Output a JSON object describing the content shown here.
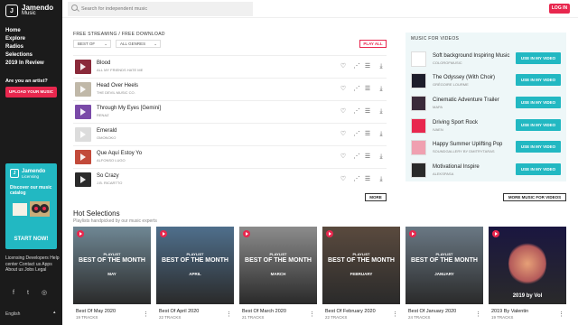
{
  "brand": {
    "mark": "J",
    "name": "Jamendo",
    "sub": "Music"
  },
  "nav": [
    "Home",
    "Explore",
    "Radios",
    "Selections",
    "2019 In Review"
  ],
  "artist_question": "Are you an artist?",
  "upload_label": "UPLOAD YOUR MUSIC",
  "licensing": {
    "title": "Jamendo",
    "sub": "Licensing",
    "text": "Discover our music catalog",
    "cta": "START NOW!"
  },
  "footer_links": "Licensing  Developers  Help center  Contact us  Apps  About us  Jobs  Legal",
  "language": "English",
  "search": {
    "placeholder": "Search for independent music"
  },
  "login_label": "LOG IN",
  "streaming_title": "FREE STREAMING / FREE DOWNLOAD",
  "filters": {
    "sort": "BEST OF",
    "genre": "ALL GENRES"
  },
  "play_all": "PLAY ALL",
  "tracks": [
    {
      "title": "Blood",
      "artist": "ALL MY FRIENDS HATE ME",
      "color": "#8a2a3a"
    },
    {
      "title": "Head Over Heels",
      "artist": "THE DEVIL MUSIC CO.",
      "color": "#c0b8a8"
    },
    {
      "title": "Through My Eyes [Gemini]",
      "artist": "RENAZ",
      "color": "#7a4aa8"
    },
    {
      "title": "Emerald",
      "artist": "OMONOKO",
      "color": "#dcdcdc"
    },
    {
      "title": "Que Aquí Estoy Yo",
      "artist": "ALFONSO LUGO",
      "color": "#c24a3a"
    },
    {
      "title": "So Crazy",
      "artist": "J.B. RICARTTO",
      "color": "#2a2a2a"
    }
  ],
  "more_label": "MORE",
  "hot_title": "Hot Selections",
  "hot_sub": "Playlists handpicked by our music experts",
  "playlists": [
    {
      "kicker": "PLAYLIST",
      "label": "BEST OF THE MONTH",
      "month": "MAY",
      "name": "Best Of May 2020",
      "count": "19 TRACKS",
      "bg": "#6f8794"
    },
    {
      "kicker": "PLAYLIST",
      "label": "BEST OF THE MONTH",
      "month": "APRIL",
      "name": "Best Of April 2020",
      "count": "22 TRACKS",
      "bg": "#4f6f8c"
    },
    {
      "kicker": "PLAYLIST",
      "label": "BEST OF THE MONTH",
      "month": "MARCH",
      "name": "Best Of March 2020",
      "count": "21 TRACKS",
      "bg": "#8c8c8c"
    },
    {
      "kicker": "PLAYLIST",
      "label": "BEST OF THE MONTH",
      "month": "FEBRUARY",
      "name": "Best Of February 2020",
      "count": "22 TRACKS",
      "bg": "#5a4a3e"
    },
    {
      "kicker": "PLAYLIST",
      "label": "BEST OF THE MONTH",
      "month": "JANUARY",
      "name": "Best Of January 2020",
      "count": "24 TRACKS",
      "bg": "#6a7884"
    },
    {
      "kicker": "",
      "label": "2019 by Vol",
      "month": "",
      "name": "2019 By Valentin",
      "count": "19 TRACKS",
      "bg": "#1a1640"
    }
  ],
  "videos_title": "MUSIC FOR VIDEOS",
  "videos": [
    {
      "title": "Soft background Inspiring Music",
      "artist": "COLOROFMUSIC",
      "color": "#ffffff"
    },
    {
      "title": "The Odyssey (With Choir)",
      "artist": "GRÉGOIRE LOURME",
      "color": "#1d1d2b"
    },
    {
      "title": "Cinematic Adventure Trailer",
      "artist": "MAPA",
      "color": "#3a2a3a"
    },
    {
      "title": "Driving Sport Rock",
      "artist": "IVAEN",
      "color": "#e8274e"
    },
    {
      "title": "Happy Summer Uplifting Pop",
      "artist": "SOUNDGALLERY BY DMITRYTARAS",
      "color": "#f0a0b0"
    },
    {
      "title": "Motivational Inspire",
      "artist": "ALEKSPASA",
      "color": "#2a2a2a"
    }
  ],
  "use_in_video": "USE IN MY VIDEO",
  "more_videos": "MORE MUSIC FOR VIDEOS"
}
